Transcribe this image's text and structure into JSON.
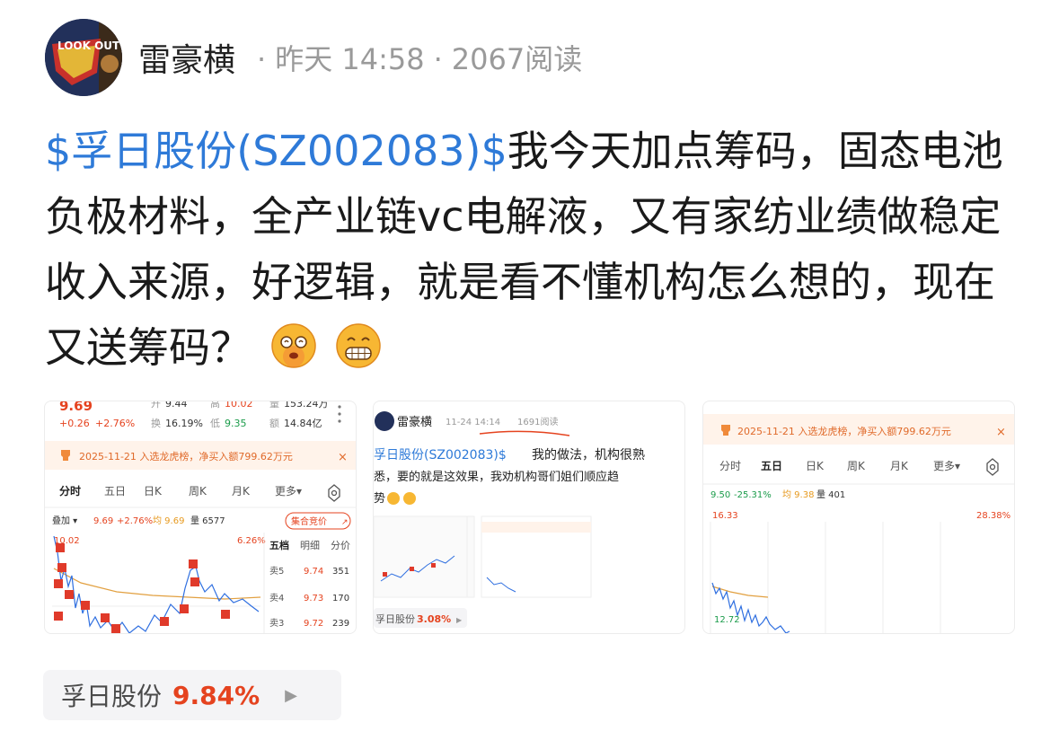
{
  "post": {
    "author": "雷豪横",
    "time": "昨天 14:58",
    "views": "2067阅读",
    "ticker": "$孚日股份(SZ002083)$",
    "body": "我今天加点筹码，固态电池负极材料，全产业链vc电解液，又有家纺业绩做稳定收入来源，好逻辑，就是看不懂机构怎么想的，现在又送筹码？"
  },
  "avatar": {
    "text": "LOOK OUT"
  },
  "emojis": [
    "dizzy-face-icon",
    "grin-face-icon"
  ],
  "thumb1": {
    "price": "9.69",
    "change": "+0.26",
    "change_pct": "+2.76%",
    "high_label": "升",
    "high": "9.44",
    "gao_label": "高",
    "gao": "10.02",
    "vol_label": "量",
    "vol": "153.24万",
    "turnover_label": "换",
    "turnover": "16.19%",
    "low_label": "低",
    "low": "9.35",
    "amount_label": "额",
    "amount": "14.84亿",
    "banner": "2025-11-21 入选龙虎榜，净买入额799.62万元",
    "tabs": [
      "分时",
      "五日",
      "日K",
      "周K",
      "月K",
      "更多▾"
    ],
    "overlay": "叠加 ▾",
    "line_info_price": "9.69",
    "line_info_pct": "+2.76%",
    "avg_label": "均 9.69",
    "vol_info": "量 6577",
    "auction_btn": "集合竞价",
    "top_price": "10.02",
    "top_pct": "6.26%",
    "level_headers": [
      "五档",
      "明细",
      "分价"
    ],
    "asks": [
      {
        "label": "卖5",
        "price": "9.74",
        "qty": "351"
      },
      {
        "label": "卖4",
        "price": "9.73",
        "qty": "170"
      },
      {
        "label": "卖3",
        "price": "9.72",
        "qty": "239"
      }
    ]
  },
  "thumb2": {
    "author": "雷豪横",
    "time": "11-24 14:14",
    "views": "1691阅读",
    "ticker": "孚日股份(SZ002083)$",
    "text1": "我的做法，机构很熟",
    "text2": "悉，要的就是这效果，我劝机构哥们姐们顺应趋",
    "text3": "势",
    "tag_name": "孚日股份",
    "tag_pct": "3.08%"
  },
  "thumb3": {
    "banner": "2025-11-21 入选龙虎榜，净买入额799.62万元",
    "tabs": [
      "分时",
      "五日",
      "日K",
      "周K",
      "月K",
      "更多▾"
    ],
    "price_line": "9.50",
    "pct_line": "-25.31%",
    "avg_line": "均 9.38",
    "vol_line": "量 401",
    "top_price": "16.33",
    "top_pct": "28.38%",
    "low_price": "12.72"
  },
  "stock_tag": {
    "name": "孚日股份",
    "pct": "9.84%"
  }
}
